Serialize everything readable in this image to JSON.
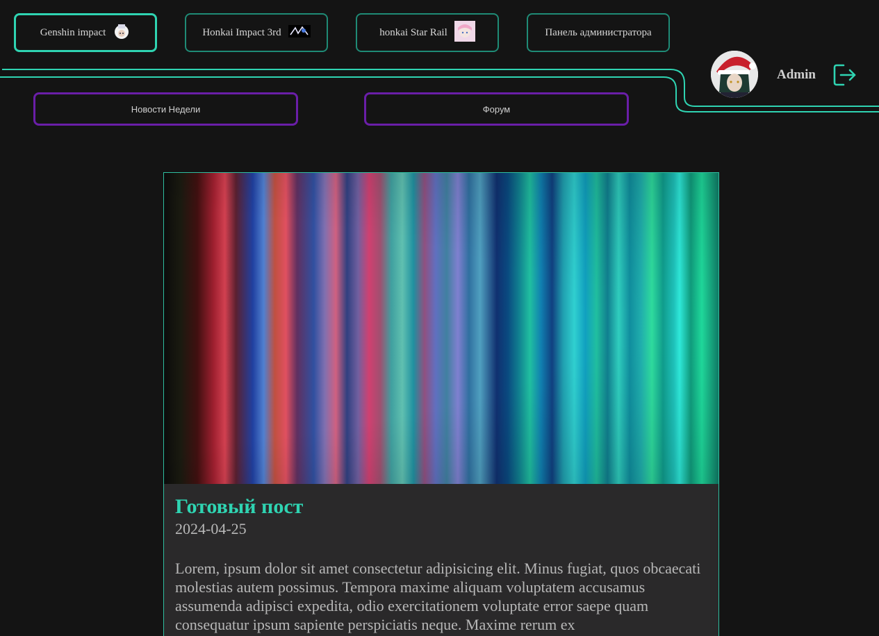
{
  "nav": {
    "top": [
      {
        "label": "Genshin impact",
        "icon": "genshin-character-icon",
        "active": true
      },
      {
        "label": "Honkai Impact 3rd",
        "icon": "honkai-impact-logo-icon",
        "active": false
      },
      {
        "label": "honkai Star Rail",
        "icon": "star-rail-character-icon",
        "active": false
      },
      {
        "label": "Панель администратора",
        "icon": null,
        "active": false
      }
    ],
    "sub": [
      {
        "label": "Новости Недели"
      },
      {
        "label": "Форум"
      }
    ]
  },
  "user": {
    "name": "Admin",
    "avatar_icon": "user-avatar-icon",
    "logout_icon": "logout-icon"
  },
  "post": {
    "title": "Готовый пост",
    "date": "2024-04-25",
    "text": "Lorem, ipsum dolor sit amet consectetur adipisicing elit. Minus fugiat, quos obcaecati molestias autem possimus. Tempora maxime aliquam voluptatem accusamus assumenda adipisci expedita, odio exercitationem voluptate error saepe quam consequatur ipsum sapiente perspiciatis neque. Maxime rerum ex"
  },
  "colors": {
    "accent": "#2fd4b2",
    "secondary": "#6a1ea8",
    "background": "#141414",
    "card": "#2a292a"
  }
}
